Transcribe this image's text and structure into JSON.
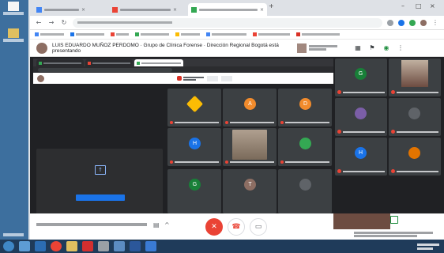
{
  "browser": {
    "tabs": [
      {
        "title": "",
        "favicon_color": "#4285f4",
        "active": false
      },
      {
        "title": "",
        "favicon_color": "#ea4335",
        "active": false
      },
      {
        "title": "",
        "favicon_color": "#34a853",
        "active": true
      }
    ],
    "address": "",
    "bookmarks": [
      "",
      "",
      "",
      "",
      "",
      "",
      "",
      ""
    ]
  },
  "meet": {
    "header_title": "LUIS EDUARDO MUÑOZ PERDOMO · Grupo de Clínica Forense · Dirección Regional Bogotá está presentando",
    "presenter_label": "",
    "shared_screen": {
      "header_label": "",
      "present_message": "",
      "present_button": ""
    },
    "tiles": [
      {
        "initial": "",
        "color": "#fbbc04",
        "name": ""
      },
      {
        "initial": "A",
        "color": "#f28b2c",
        "name": ""
      },
      {
        "initial": "D",
        "color": "#f28b2c",
        "name": ""
      },
      {
        "initial": "H",
        "color": "#1a73e8",
        "name": ""
      },
      {
        "initial": "",
        "color": "#6d4c41",
        "name": ""
      },
      {
        "initial": "",
        "color": "#34a853",
        "name": ""
      },
      {
        "initial": "G",
        "color": "#188038",
        "name": ""
      },
      {
        "initial": "T",
        "color": "#8d6e63",
        "name": ""
      },
      {
        "initial": "",
        "color": "#5f6368",
        "name": ""
      }
    ],
    "right_tiles": [
      {
        "initial": "G",
        "color": "#188038",
        "name": ""
      },
      {
        "initial": "",
        "color": "#6d4c41",
        "name": ""
      },
      {
        "initial": "",
        "color": "#7b5ea7",
        "name": ""
      },
      {
        "initial": "",
        "color": "#5f6368",
        "name": ""
      },
      {
        "initial": "H",
        "color": "#1a73e8",
        "name": ""
      },
      {
        "initial": "",
        "color": "#e37400",
        "name": ""
      }
    ],
    "controls": {
      "meeting_code": "",
      "self_name": ""
    },
    "colors": {
      "hangup": "#ea4335",
      "accent": "#1a73e8"
    }
  }
}
